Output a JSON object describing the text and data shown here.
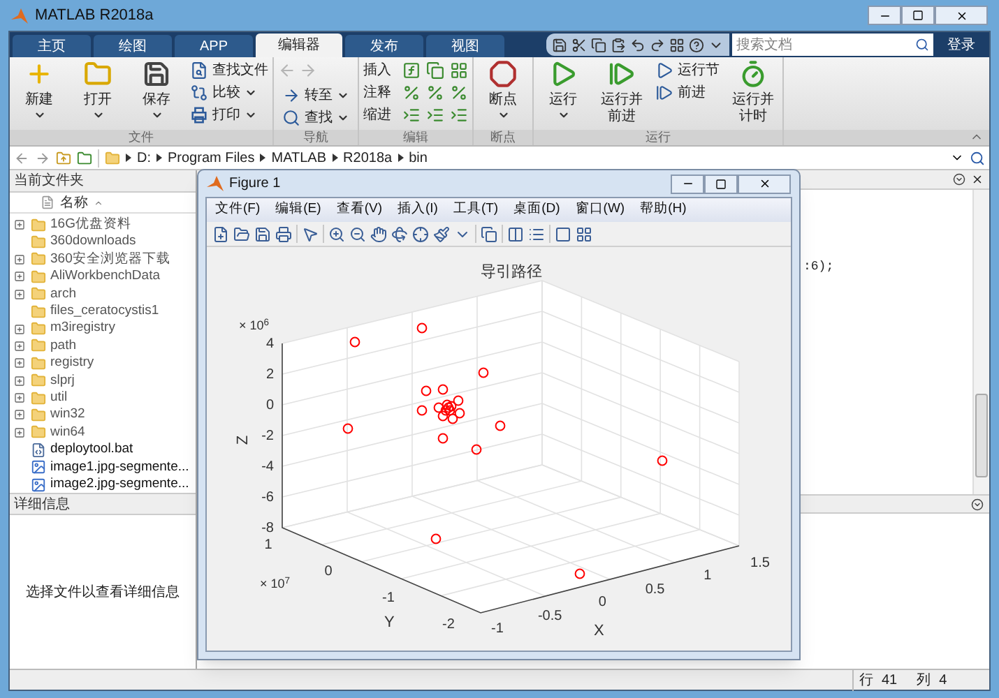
{
  "window": {
    "title": "MATLAB R2018a"
  },
  "tabs": [
    {
      "label": "主页",
      "selected": false
    },
    {
      "label": "绘图",
      "selected": false
    },
    {
      "label": "APP",
      "selected": false
    },
    {
      "label": "编辑器",
      "selected": true
    },
    {
      "label": "发布",
      "selected": false
    },
    {
      "label": "视图",
      "selected": false
    }
  ],
  "search": {
    "placeholder": "搜索文档"
  },
  "sign_in": "登录",
  "ribbon": [
    {
      "label": "文件",
      "controls": [
        {
          "kind": "large",
          "label": "新建",
          "dropdown": true
        },
        {
          "kind": "large",
          "label": "打开",
          "dropdown": true
        },
        {
          "kind": "large",
          "label": "保存",
          "dropdown": true
        },
        {
          "kind": "small",
          "label": "查找文件",
          "dropdown": false
        },
        {
          "kind": "small",
          "label": "比较",
          "dropdown": true
        },
        {
          "kind": "small",
          "label": "打印",
          "dropdown": true
        }
      ]
    },
    {
      "label": "导航",
      "controls": [
        {
          "kind": "small",
          "label": "转至",
          "dropdown": true
        },
        {
          "kind": "small",
          "label": "查找",
          "dropdown": true
        }
      ]
    },
    {
      "label": "编辑",
      "controls": [
        {
          "kind": "row",
          "label": "插入"
        },
        {
          "kind": "row",
          "label": "注释"
        },
        {
          "kind": "row",
          "label": "缩进"
        }
      ]
    },
    {
      "label": "断点",
      "controls": [
        {
          "kind": "large",
          "label": "断点",
          "dropdown": true
        }
      ]
    },
    {
      "label": "运行",
      "controls": [
        {
          "kind": "large",
          "label": "运行",
          "dropdown": true
        },
        {
          "kind": "large",
          "label": "运行并前进",
          "dropdown": false
        },
        {
          "kind": "small",
          "label": "运行节",
          "dropdown": false
        },
        {
          "kind": "small",
          "label": "前进",
          "dropdown": false
        },
        {
          "kind": "large",
          "label": "运行并计时",
          "dropdown": false
        }
      ]
    }
  ],
  "address": [
    "D:",
    "Program Files",
    "MATLAB",
    "R2018a",
    "bin"
  ],
  "current_folder": {
    "title": "当前文件夹",
    "column": "名称",
    "files": [
      {
        "name": "16G优盘资料",
        "kind": "folder",
        "expandable": true
      },
      {
        "name": "360downloads",
        "kind": "folder",
        "expandable": false
      },
      {
        "name": "360安全浏览器下载",
        "kind": "folder",
        "expandable": true
      },
      {
        "name": "AliWorkbenchData",
        "kind": "folder",
        "expandable": true
      },
      {
        "name": "arch",
        "kind": "folder",
        "expandable": true
      },
      {
        "name": "files_ceratocystis1",
        "kind": "folder",
        "expandable": false
      },
      {
        "name": "m3iregistry",
        "kind": "folder",
        "expandable": true
      },
      {
        "name": "path",
        "kind": "folder",
        "expandable": true
      },
      {
        "name": "registry",
        "kind": "folder",
        "expandable": true
      },
      {
        "name": "slprj",
        "kind": "folder",
        "expandable": true
      },
      {
        "name": "util",
        "kind": "folder",
        "expandable": true
      },
      {
        "name": "win32",
        "kind": "folder",
        "expandable": true
      },
      {
        "name": "win64",
        "kind": "folder",
        "expandable": true
      },
      {
        "name": "deploytool.bat",
        "kind": "script",
        "expandable": false
      },
      {
        "name": "image1.jpg-segmente...",
        "kind": "image",
        "expandable": false
      },
      {
        "name": "image2.jpg-segmente...",
        "kind": "image",
        "expandable": false
      }
    ]
  },
  "details": {
    "title": "详细信息",
    "message": "选择文件以查看详细信息"
  },
  "editor": {
    "code_fragment": ":6);"
  },
  "status_bar": {
    "row_label": "行",
    "row": "41",
    "col_label": "列",
    "col": "4"
  },
  "figure": {
    "title": "Figure 1",
    "menus": [
      "文件(F)",
      "编辑(E)",
      "查看(V)",
      "插入(I)",
      "工具(T)",
      "桌面(D)",
      "窗口(W)",
      "帮助(H)"
    ],
    "plot": {
      "title": "导引路径",
      "xlabel": "X",
      "ylabel": "Y",
      "zlabel": "Z",
      "z_multiplier": "× 10$^{6}$",
      "y_multiplier": "× 10$^{7}$",
      "z_tick_labels": [
        "4",
        "2",
        "0",
        "-2",
        "-4",
        "-6",
        "-8"
      ],
      "y_tick_labels": [
        "1",
        "0",
        "-1",
        "-2"
      ],
      "x_tick_labels": [
        "-1",
        "-0.5",
        "0",
        "0.5",
        "1",
        "1.5"
      ]
    }
  }
}
